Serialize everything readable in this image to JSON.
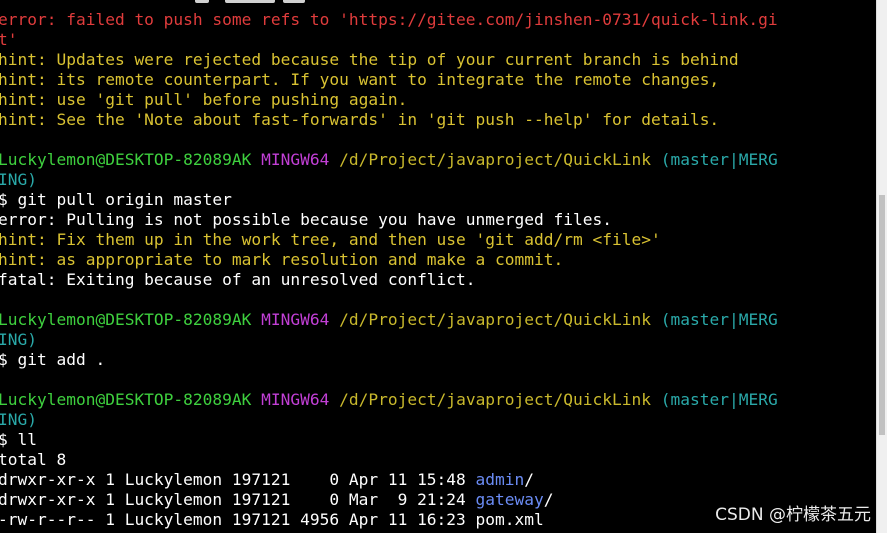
{
  "terminal": {
    "lines": [
      {
        "segments": [
          {
            "text": "error: failed to push some refs to 'https://gitee.com/jinshen-0731/quick-link.gi",
            "color": "red"
          }
        ]
      },
      {
        "segments": [
          {
            "text": "t'",
            "color": "red"
          }
        ]
      },
      {
        "segments": [
          {
            "text": "hint: Updates were rejected because the tip of your current branch is behind",
            "color": "yellow"
          }
        ]
      },
      {
        "segments": [
          {
            "text": "hint: its remote counterpart. If you want to integrate the remote changes,",
            "color": "yellow"
          }
        ]
      },
      {
        "segments": [
          {
            "text": "hint: use 'git pull' before pushing again.",
            "color": "yellow"
          }
        ]
      },
      {
        "segments": [
          {
            "text": "hint: See the 'Note about fast-forwards' in 'git push --help' for details.",
            "color": "yellow"
          }
        ]
      },
      {
        "segments": [
          {
            "text": "",
            "color": "white"
          }
        ]
      },
      {
        "segments": [
          {
            "text": "Luckylemon@DESKTOP-82089AK",
            "color": "green"
          },
          {
            "text": " ",
            "color": "white"
          },
          {
            "text": "MINGW64",
            "color": "magenta"
          },
          {
            "text": " ",
            "color": "white"
          },
          {
            "text": "/d/Project/javaproject/QuickLink",
            "color": "gold"
          },
          {
            "text": " ",
            "color": "white"
          },
          {
            "text": "(master|MERG",
            "color": "cyan"
          }
        ]
      },
      {
        "segments": [
          {
            "text": "ING)",
            "color": "cyan"
          }
        ]
      },
      {
        "segments": [
          {
            "text": "$ git pull origin master",
            "color": "white"
          }
        ]
      },
      {
        "segments": [
          {
            "text": "error: Pulling is not possible because you have unmerged files.",
            "color": "white"
          }
        ]
      },
      {
        "segments": [
          {
            "text": "hint: Fix them up in the work tree, and then use 'git add/rm <file>'",
            "color": "yellow"
          }
        ]
      },
      {
        "segments": [
          {
            "text": "hint: as appropriate to mark resolution and make a commit.",
            "color": "yellow"
          }
        ]
      },
      {
        "segments": [
          {
            "text": "fatal: Exiting because of an unresolved conflict.",
            "color": "white"
          }
        ]
      },
      {
        "segments": [
          {
            "text": "",
            "color": "white"
          }
        ]
      },
      {
        "segments": [
          {
            "text": "Luckylemon@DESKTOP-82089AK",
            "color": "green"
          },
          {
            "text": " ",
            "color": "white"
          },
          {
            "text": "MINGW64",
            "color": "magenta"
          },
          {
            "text": " ",
            "color": "white"
          },
          {
            "text": "/d/Project/javaproject/QuickLink",
            "color": "gold"
          },
          {
            "text": " ",
            "color": "white"
          },
          {
            "text": "(master|MERG",
            "color": "cyan"
          }
        ]
      },
      {
        "segments": [
          {
            "text": "ING)",
            "color": "cyan"
          }
        ]
      },
      {
        "segments": [
          {
            "text": "$ git add .",
            "color": "white"
          }
        ]
      },
      {
        "segments": [
          {
            "text": "",
            "color": "white"
          }
        ]
      },
      {
        "segments": [
          {
            "text": "Luckylemon@DESKTOP-82089AK",
            "color": "green"
          },
          {
            "text": " ",
            "color": "white"
          },
          {
            "text": "MINGW64",
            "color": "magenta"
          },
          {
            "text": " ",
            "color": "white"
          },
          {
            "text": "/d/Project/javaproject/QuickLink",
            "color": "gold"
          },
          {
            "text": " ",
            "color": "white"
          },
          {
            "text": "(master|MERG",
            "color": "cyan"
          }
        ]
      },
      {
        "segments": [
          {
            "text": "ING)",
            "color": "cyan"
          }
        ]
      },
      {
        "segments": [
          {
            "text": "$ ll",
            "color": "white"
          }
        ]
      },
      {
        "segments": [
          {
            "text": "total 8",
            "color": "white"
          }
        ]
      },
      {
        "segments": [
          {
            "text": "drwxr-xr-x 1 Luckylemon 197121    0 Apr 11 15:48 ",
            "color": "white"
          },
          {
            "text": "admin",
            "color": "blue"
          },
          {
            "text": "/",
            "color": "white"
          }
        ]
      },
      {
        "segments": [
          {
            "text": "drwxr-xr-x 1 Luckylemon 197121    0 Mar  9 21:24 ",
            "color": "white"
          },
          {
            "text": "gateway",
            "color": "blue"
          },
          {
            "text": "/",
            "color": "white"
          }
        ]
      },
      {
        "segments": [
          {
            "text": "-rw-r--r-- 1 Luckylemon 197121 4956 Apr 11 16:23 pom.xml",
            "color": "white"
          }
        ]
      }
    ]
  },
  "watermark": "CSDN @柠檬茶五元",
  "colors": {
    "red": "#e03c3c",
    "yellow": "#d9c232",
    "green": "#3ed03e",
    "magenta": "#c23fd6",
    "gold": "#c8b82c",
    "cyan": "#2aa9a9",
    "blue": "#6b8cf5",
    "white": "#ffffff",
    "background": "#000000"
  }
}
